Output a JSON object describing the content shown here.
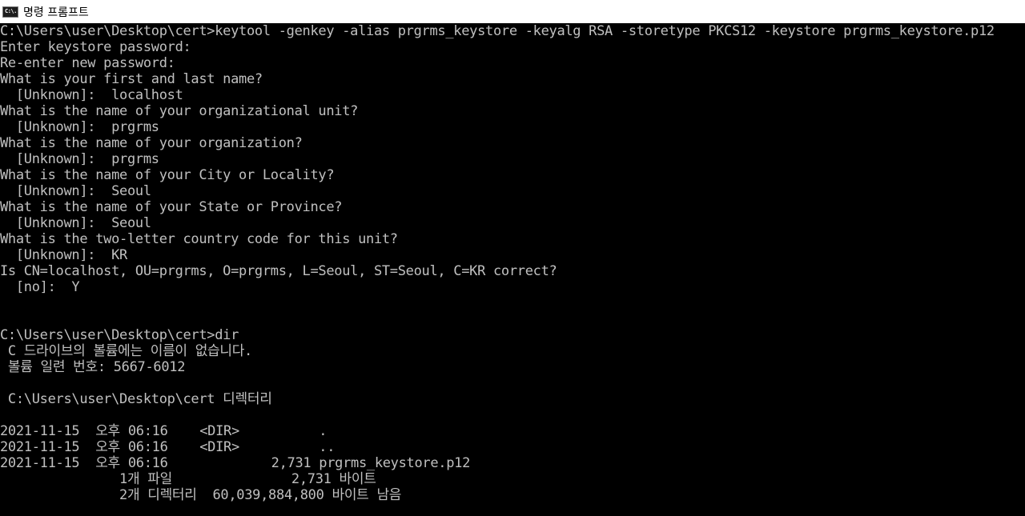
{
  "window": {
    "title": "명령 프롬프트",
    "icon_label": "C:\\."
  },
  "console": {
    "lines": [
      "C:\\Users\\user\\Desktop\\cert>keytool -genkey -alias prgrms_keystore -keyalg RSA -storetype PKCS12 -keystore prgrms_keystore.p12",
      "Enter keystore password:",
      "Re-enter new password:",
      "What is your first and last name?",
      "  [Unknown]:  localhost",
      "What is the name of your organizational unit?",
      "  [Unknown]:  prgrms",
      "What is the name of your organization?",
      "  [Unknown]:  prgrms",
      "What is the name of your City or Locality?",
      "  [Unknown]:  Seoul",
      "What is the name of your State or Province?",
      "  [Unknown]:  Seoul",
      "What is the two-letter country code for this unit?",
      "  [Unknown]:  KR",
      "Is CN=localhost, OU=prgrms, O=prgrms, L=Seoul, ST=Seoul, C=KR correct?",
      "  [no]:  Y",
      "",
      "",
      "C:\\Users\\user\\Desktop\\cert>dir",
      " C 드라이브의 볼륨에는 이름이 없습니다.",
      " 볼륨 일련 번호: 5667-6012",
      "",
      " C:\\Users\\user\\Desktop\\cert 디렉터리",
      "",
      "2021-11-15  오후 06:16    <DIR>          .",
      "2021-11-15  오후 06:16    <DIR>          ..",
      "2021-11-15  오후 06:16             2,731 prgrms_keystore.p12",
      "               1개 파일               2,731 바이트",
      "               2개 디렉터리  60,039,884,800 바이트 남음"
    ]
  },
  "colors": {
    "background": "#000000",
    "text": "#c0c0c0",
    "titlebar": "#ffffff"
  }
}
